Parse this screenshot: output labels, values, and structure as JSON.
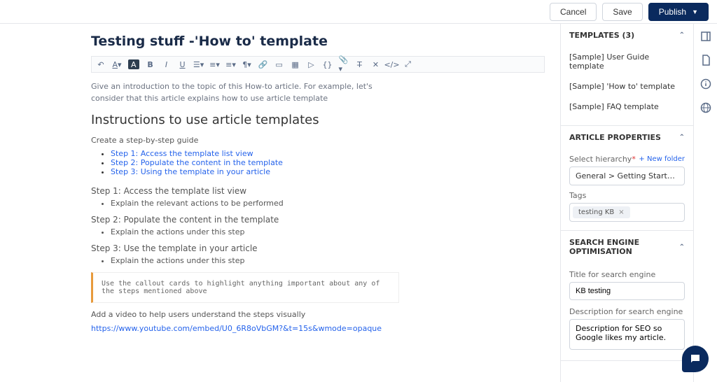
{
  "header": {
    "cancel": "Cancel",
    "save": "Save",
    "publish": "Publish"
  },
  "article": {
    "title": "Testing stuff -'How to' template",
    "intro": "Give an introduction to the topic of this How-to article. For example, let's consider that this article explains how to use article template",
    "subheading": "Instructions to use article templates",
    "toc_intro": "Create a step-by-step guide",
    "toc": [
      "Step 1: Access the template list view",
      "Step 2: Populate the content in the template",
      "Step 3: Using the template in your article"
    ],
    "steps": [
      {
        "title": "Step 1: Access the template list view",
        "detail": "Explain the relevant actions to be performed"
      },
      {
        "title": "Step 2: Populate the content in the template",
        "detail": "Explain the actions under this step"
      },
      {
        "title": "Step 3: Use the template in your article",
        "detail": "Explain the actions under this step"
      }
    ],
    "callout": "Use the callout cards to highlight anything important about any of the steps mentioned above",
    "video_intro": "Add a video to help users understand the steps visually",
    "video_url": "https://www.youtube.com/embed/U0_6R8oVbGM?&t=15s&wmode=opaque"
  },
  "templates": {
    "heading": "TEMPLATES (3)",
    "items": [
      "[Sample] User Guide template",
      "[Sample] 'How to' template",
      "[Sample] FAQ template"
    ]
  },
  "properties": {
    "heading": "ARTICLE PROPERTIES",
    "hierarchy_label": "Select hierarchy",
    "new_folder": "+ New folder",
    "hierarchy_value": "General > Getting Started > Account Sett",
    "tags_label": "Tags",
    "tags": [
      "testing KB"
    ]
  },
  "seo": {
    "heading": "SEARCH ENGINE OPTIMISATION",
    "title_label": "Title for search engine",
    "title_value": "KB testing",
    "desc_label": "Description for search engine",
    "desc_value": "Description for SEO so Google likes my article."
  }
}
